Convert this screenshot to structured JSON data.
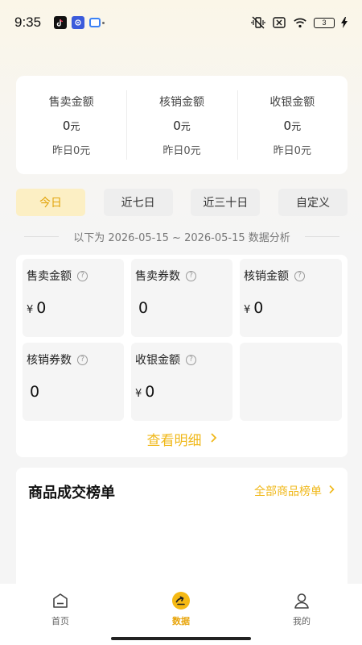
{
  "status_bar": {
    "time": "9:35",
    "battery": "3",
    "left_icons": [
      "tiktok-icon",
      "app-icon",
      "camera-icon"
    ],
    "right_icons": [
      "vibrate-off-icon",
      "no-sim-icon",
      "wifi-icon",
      "battery-icon",
      "charging-icon"
    ]
  },
  "summary": {
    "columns": [
      {
        "label": "售卖金额",
        "value": "0",
        "unit": "元",
        "yesterday": "昨日0元"
      },
      {
        "label": "核销金额",
        "value": "0",
        "unit": "元",
        "yesterday": "昨日0元"
      },
      {
        "label": "收银金额",
        "value": "0",
        "unit": "元",
        "yesterday": "昨日0元"
      }
    ]
  },
  "date_tabs": [
    {
      "label": "今日",
      "active": true
    },
    {
      "label": "近七日",
      "active": false
    },
    {
      "label": "近三十日",
      "active": false
    },
    {
      "label": "自定义",
      "active": false
    }
  ],
  "range_text": "以下为 2026-05-15 ~ 2026-05-15 数据分析",
  "metrics": [
    {
      "label": "售卖金额",
      "currency": "¥",
      "value": "0"
    },
    {
      "label": "售卖券数",
      "currency": "",
      "value": "0"
    },
    {
      "label": "核销金额",
      "currency": "¥",
      "value": "0"
    },
    {
      "label": "核销券数",
      "currency": "",
      "value": "0"
    },
    {
      "label": "收银金额",
      "currency": "¥",
      "value": "0"
    }
  ],
  "detail_link": "查看明细",
  "ranking": {
    "title": "商品成交榜单",
    "all_link": "全部商品榜单"
  },
  "bottom_nav": [
    {
      "label": "首页",
      "icon": "home-icon",
      "active": false
    },
    {
      "label": "数据",
      "icon": "data-icon",
      "active": true
    },
    {
      "label": "我的",
      "icon": "profile-icon",
      "active": false
    }
  ],
  "colors": {
    "accent": "#f0b81a",
    "active_tab_bg": "#fcefc4",
    "active_tab_text": "#e2a40b"
  }
}
